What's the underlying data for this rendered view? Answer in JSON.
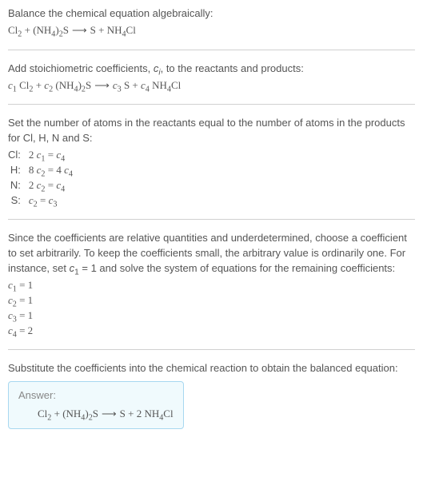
{
  "section1": {
    "intro": "Balance the chemical equation algebraically:",
    "eq": "Cl₂ + (NH₄)₂S ⟶ S + NH₄Cl"
  },
  "section2": {
    "intro_a": "Add stoichiometric coefficients, ",
    "intro_ci": "cᵢ",
    "intro_b": ", to the reactants and products:",
    "eq": "c₁ Cl₂ + c₂ (NH₄)₂S ⟶ c₃ S + c₄ NH₄Cl"
  },
  "section3": {
    "intro": "Set the number of atoms in the reactants equal to the number of atoms in the products for Cl, H, N and S:",
    "rows": [
      {
        "el": "Cl:",
        "eq": "2 c₁ = c₄"
      },
      {
        "el": "H:",
        "eq": "8 c₂ = 4 c₄"
      },
      {
        "el": "N:",
        "eq": "2 c₂ = c₄"
      },
      {
        "el": "S:",
        "eq": "c₂ = c₃"
      }
    ]
  },
  "section4": {
    "intro": "Since the coefficients are relative quantities and underdetermined, choose a coefficient to set arbitrarily. To keep the coefficients small, the arbitrary value is ordinarily one. For instance, set c₁ = 1 and solve the system of equations for the remaining coefficients:",
    "coefs": [
      "c₁ = 1",
      "c₂ = 1",
      "c₃ = 1",
      "c₄ = 2"
    ]
  },
  "section5": {
    "intro": "Substitute the coefficients into the chemical reaction to obtain the balanced equation:",
    "answer_label": "Answer:",
    "answer_eq": "Cl₂ + (NH₄)₂S ⟶ S + 2 NH₄Cl"
  }
}
